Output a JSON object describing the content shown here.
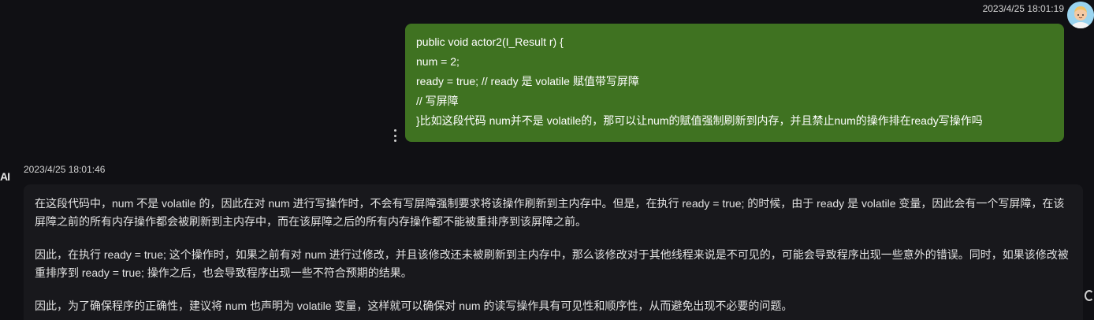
{
  "user_message": {
    "timestamp": "2023/4/25 18:01:19",
    "lines": [
      "public void actor2(I_Result r) {",
      "num = 2;",
      "ready = true; // ready 是 volatile 赋值带写屏障",
      "// 写屏障",
      "}比如这段代码 num并不是 volatile的，那可以让num的赋值强制刷新到内存，并且禁止num的操作排在ready写操作吗"
    ]
  },
  "ai_message": {
    "avatar_label": "AI",
    "timestamp": "2023/4/25 18:01:46",
    "paragraphs": [
      "在这段代码中，num 不是 volatile 的，因此在对 num 进行写操作时，不会有写屏障强制要求将该操作刷新到主内存中。但是，在执行 ready = true; 的时候，由于 ready 是 volatile 变量，因此会有一个写屏障，在该屏障之前的所有内存操作都会被刷新到主内存中，而在该屏障之后的所有内存操作都不能被重排序到该屏障之前。",
      "因此，在执行 ready = true; 这个操作时，如果之前有对 num 进行过修改，并且该修改还未被刷新到主内存中，那么该修改对于其他线程来说是不可见的，可能会导致程序出现一些意外的错误。同时，如果该修改被重排序到 ready = true; 操作之后，也会导致程序出现一些不符合预期的结果。",
      "因此，为了确保程序的正确性，建议将 num 也声明为 volatile 变量，这样就可以确保对 num 的读写操作具有可见性和顺序性，从而避免出现不必要的问题。"
    ]
  },
  "colors": {
    "user_bubble": "#3f7221",
    "ai_bubble": "#18181c",
    "background": "#101014"
  }
}
